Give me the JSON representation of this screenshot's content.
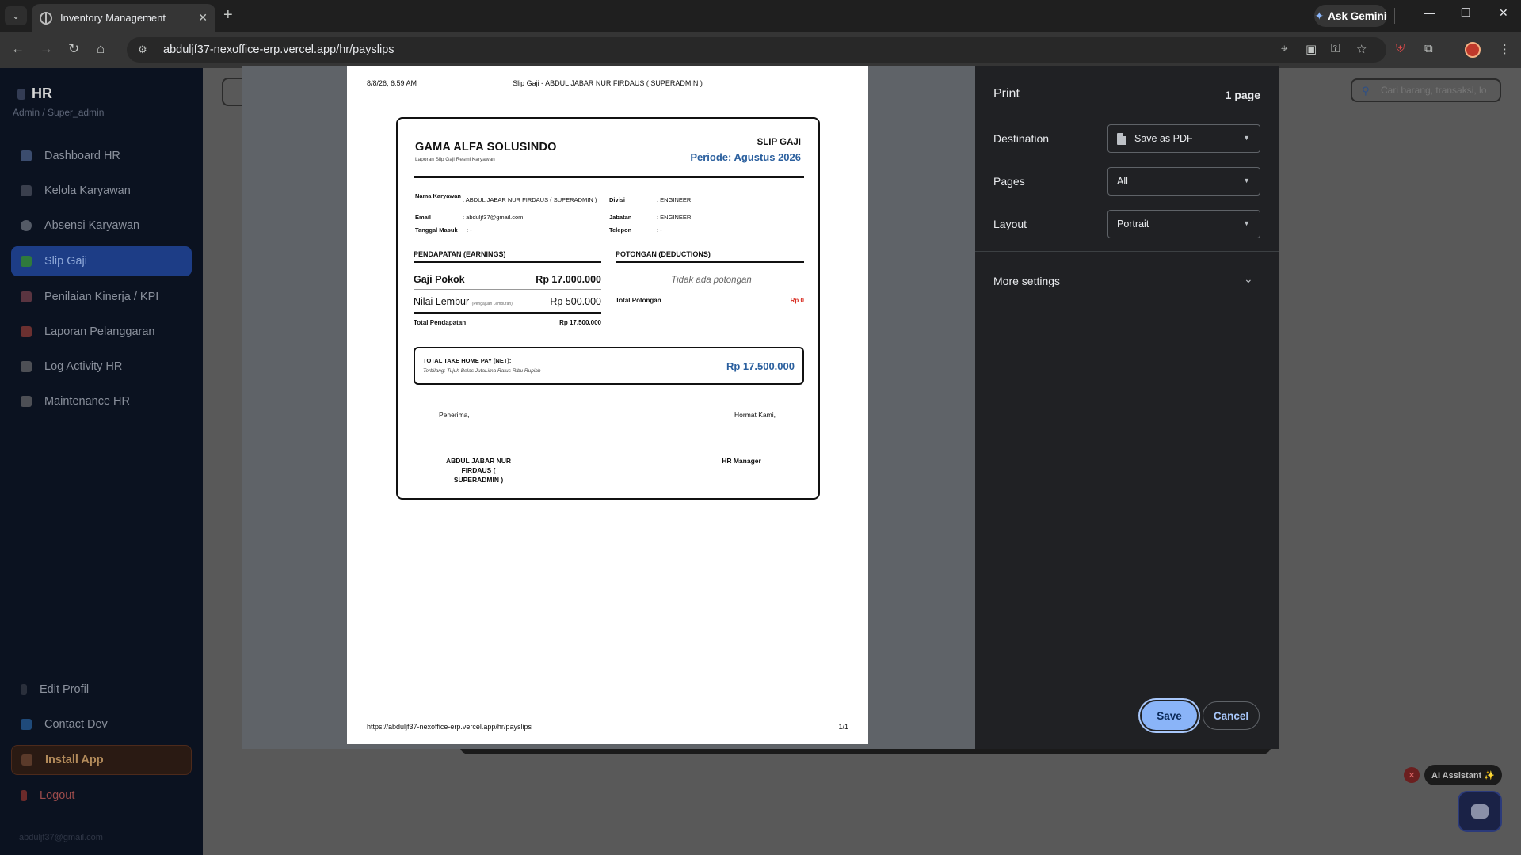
{
  "browser": {
    "tab_title": "Inventory Management",
    "url": "abduljf37-nexoffice-erp.vercel.app/hr/payslips",
    "ask_gemini": "Ask Gemini"
  },
  "sidebar": {
    "brand": "HR",
    "role": "Admin / Super_admin",
    "items": [
      {
        "label": "Dashboard HR"
      },
      {
        "label": "Kelola Karyawan"
      },
      {
        "label": "Absensi Karyawan"
      },
      {
        "label": "Slip Gaji"
      },
      {
        "label": "Penilaian Kinerja / KPI"
      },
      {
        "label": "Laporan Pelanggaran"
      },
      {
        "label": "Log Activity HR"
      },
      {
        "label": "Maintenance HR"
      }
    ],
    "bottom": {
      "edit_profile": "Edit Profil",
      "contact_dev": "Contact Dev",
      "install_app": "Install App",
      "logout": "Logout",
      "email": "abduljf37@gmail.com"
    }
  },
  "background": {
    "search_placeholder": "Cari barang, transaksi, lo",
    "ai_assistant": "AI Assistant ✨"
  },
  "print_preview": {
    "header_date": "8/8/26, 6:59 AM",
    "header_title": "Slip Gaji - ABDUL JABAR NUR FIRDAUS ( SUPERADMIN )",
    "footer_url": "https://abduljf37-nexoffice-erp.vercel.app/hr/payslips",
    "footer_page": "1/1",
    "slip": {
      "company": "GAMA ALFA SOLUSINDO",
      "company_sub": "Laporan Slip Gaji Resmi Karyawan",
      "title": "SLIP GAJI",
      "period": "Periode: Agustus 2026",
      "name_label": "Nama Karyawan",
      "name_value": ": ABDUL JABAR NUR FIRDAUS ( SUPERADMIN )",
      "email_label": "Email",
      "email_value": ": abduljf37@gmail.com",
      "join_label": "Tanggal Masuk",
      "join_value": ": -",
      "division_label": "Divisi",
      "division_value": ": ENGINEER",
      "position_label": "Jabatan",
      "position_value": ": ENGINEER",
      "phone_label": "Telepon",
      "phone_value": ": -",
      "earnings_title": "PENDAPATAN (EARNINGS)",
      "deductions_title": "POTONGAN (DEDUCTIONS)",
      "base_salary_label": "Gaji Pokok",
      "base_salary_value": "Rp 17.000.000",
      "overtime_label": "Nilai Lembur",
      "overtime_note": "(Pengajuan Lemburan)",
      "overtime_value": "Rp 500.000",
      "total_earnings_label": "Total Pendapatan",
      "total_earnings_value": "Rp 17.500.000",
      "no_deductions": "Tidak ada potongan",
      "total_deductions_label": "Total Potongan",
      "total_deductions_value": "Rp 0",
      "net_label": "TOTAL TAKE HOME PAY (NET):",
      "net_words": "Terbilang: Tujuh Belas JutaLima Ratus Ribu Rupiah",
      "net_value": "Rp 17.500.000",
      "receiver_label": "Penerima,",
      "regards_label": "Hormat Kami,",
      "receiver_name": "ABDUL JABAR NUR FIRDAUS ( SUPERADMIN )",
      "manager_name": "HR Manager"
    }
  },
  "print_panel": {
    "title": "Print",
    "page_count": "1 page",
    "destination_label": "Destination",
    "destination_value": "Save as PDF",
    "pages_label": "Pages",
    "pages_value": "All",
    "layout_label": "Layout",
    "layout_value": "Portrait",
    "more_settings": "More settings",
    "save": "Save",
    "cancel": "Cancel"
  },
  "colors": {
    "accent_blue": "#8ab4f8",
    "slip_blue": "#2a5f9e",
    "deduction_red": "#d93025"
  }
}
